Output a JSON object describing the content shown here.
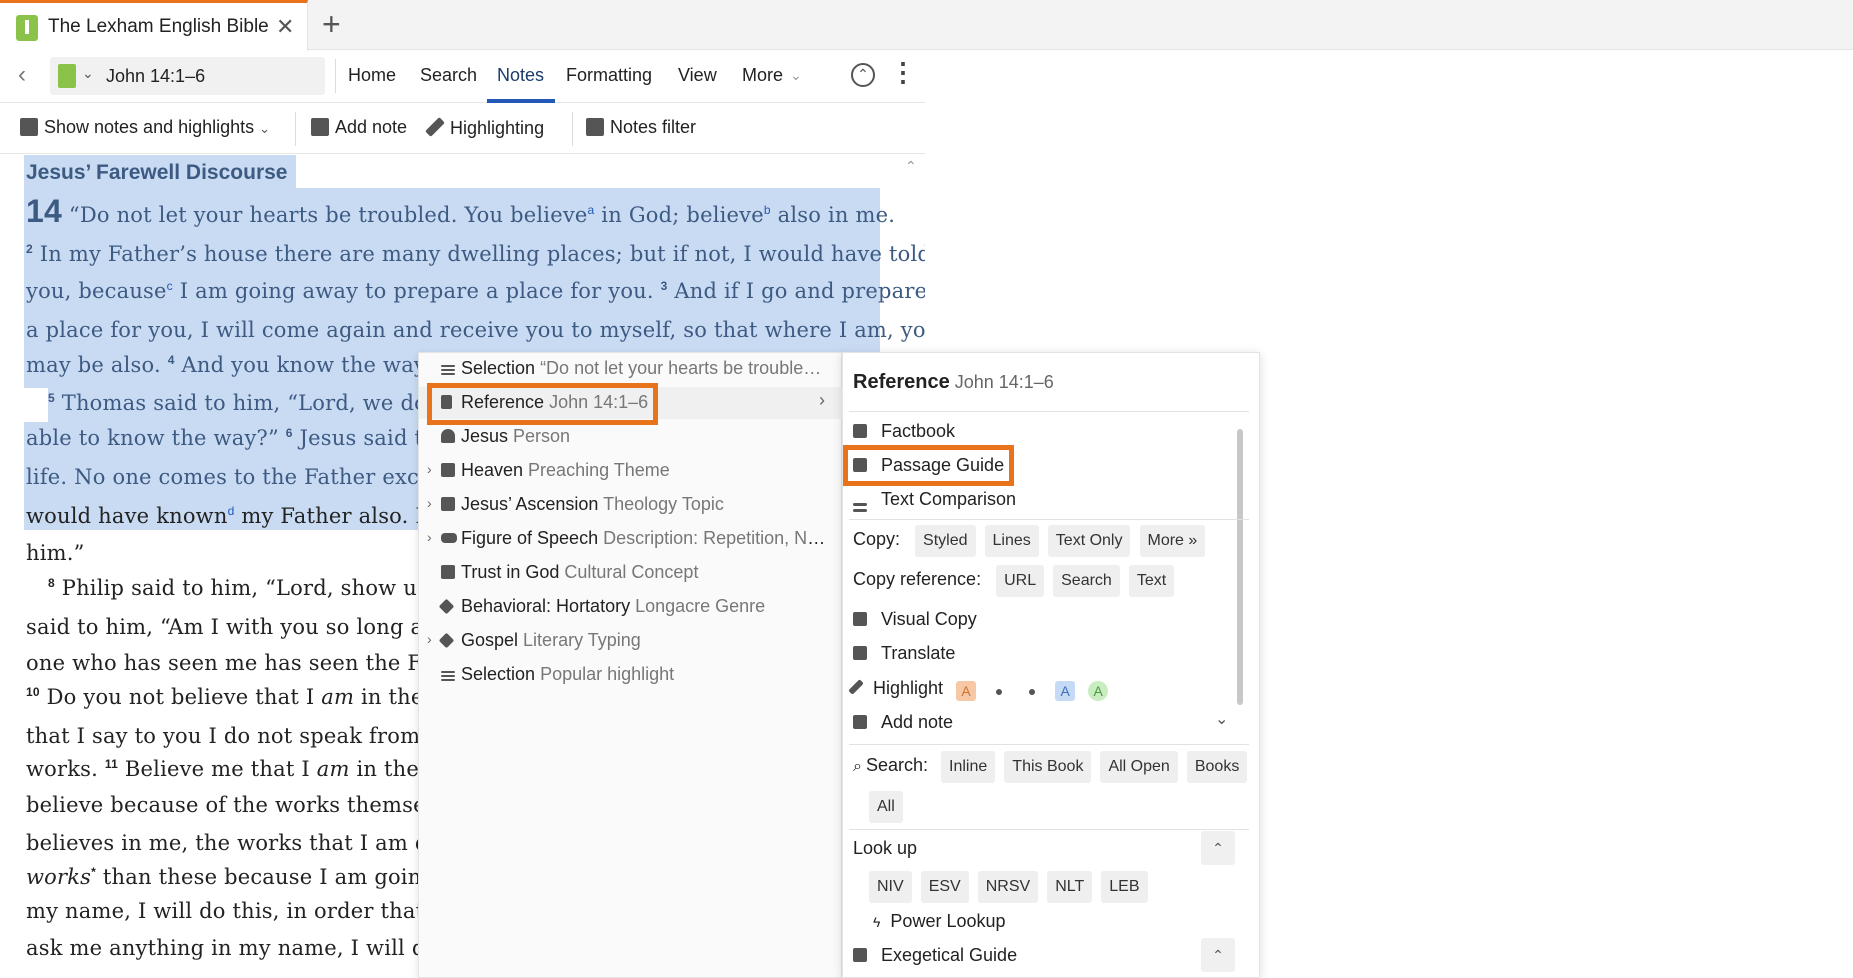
{
  "tab": {
    "title": "The Lexham English Bible",
    "close": "✕",
    "add": "+"
  },
  "nav": {
    "back": "‹",
    "reference": "John 14:1–6",
    "dropdown": "⌄",
    "menu": [
      "Home",
      "Search",
      "Notes",
      "Formatting",
      "View",
      "More"
    ],
    "more_chevron": "⌄",
    "active": "Notes"
  },
  "toolbar": {
    "show_notes": "Show notes and highlights",
    "show_chevron": "⌄",
    "add_note": "Add note",
    "highlighting": "Highlighting",
    "notes_filter": "Notes filter"
  },
  "text": {
    "heading": "Jesus’ Farewell Discourse",
    "chapter": "14",
    "l1": "“Do not let your hearts be troubled. You believe",
    "l1_note_a": "a",
    "l1_b": " in God; believe",
    "l1_note_b": "b",
    "l1_c": " also in me.",
    "v2": "2",
    "l2": " In my Father’s house there are many dwelling places; but if not, I would have told",
    "l3a": "you, because",
    "l3_note_c": "c",
    "l3b": " I am going away to prepare a place for you. ",
    "v3": "3",
    "l3c": " And if I go and prepare",
    "l4": "a place for you, I will come again and receive you to myself, so that where I am, you",
    "l5a": "may be also. ",
    "v4": "4",
    "l5b": " And you know the way w",
    "v5": "5",
    "l6": " Thomas said to him, “Lord, we do",
    "l7a": "able to know the way?” ",
    "v6": "6",
    "l7b": " Jesus said to",
    "l8": "life. No one comes to the Father exce",
    "l9a": "would have known",
    "l9_note_d": "d",
    "l9b": " my Father also. F",
    "l10": "him.”",
    "v8": "8",
    "l11": " Philip said to him, “Lord, show us",
    "l12": "said to him, “Am I with you so long a ti",
    "l13": "one who has seen me has seen the Fat",
    "v10": "10",
    "l14a": " Do you not believe that I ",
    "l14_am": "am",
    "l14b": " in the",
    "l15": "that I say to you I do not speak from m",
    "l16a": "works. ",
    "v11": "11",
    "l16b": " Believe me that I ",
    "l16_am": "am",
    "l16c": " in the",
    "l17": "believe because of the works themsel",
    "l18": "believes in me, the works that I am d",
    "l19a": "works",
    "l19_star": "*",
    "l19b": " than these because I am going",
    "l20": "my name, I will do this, in order that th",
    "l21": "ask me anything in my name, I will do i",
    "scroll_up": "⌃"
  },
  "menu1": {
    "items": [
      {
        "label": "Selection",
        "sub": " “Do not let your hearts be trouble…",
        "chev": ""
      },
      {
        "label": "Reference",
        "sub": " John 14:1–6",
        "chev": ""
      },
      {
        "label": "Jesus",
        "sub": " Person",
        "chev": ""
      },
      {
        "label": "Heaven",
        "sub": " Preaching Theme",
        "chev": "›"
      },
      {
        "label": "Jesus’ Ascension",
        "sub": " Theology Topic",
        "chev": "›"
      },
      {
        "label": "Figure of Speech",
        "sub": " Description: Repetition, Na…",
        "chev": "›"
      },
      {
        "label": "Trust in God",
        "sub": " Cultural Concept",
        "chev": ""
      },
      {
        "label": "Behavioral: Hortatory",
        "sub": " Longacre Genre",
        "chev": ""
      },
      {
        "label": "Gospel",
        "sub": " Literary Typing",
        "chev": "›"
      },
      {
        "label": "Selection",
        "sub": " Popular highlight",
        "chev": ""
      }
    ],
    "arrow": "›"
  },
  "menu2": {
    "title": "Reference",
    "title_sub": " John 14:1–6",
    "factbook": "Factbook",
    "passage_guide": "Passage Guide",
    "text_comparison": "Text Comparison",
    "copy_label": "Copy:",
    "copy_chips": [
      "Styled",
      "Lines",
      "Text Only",
      "More »"
    ],
    "copy_ref_label": "Copy reference:",
    "copy_ref_chips": [
      "URL",
      "Search",
      "Text"
    ],
    "visual_copy": "Visual Copy",
    "translate": "Translate",
    "highlight": "Highlight",
    "highlight_chip_a": "A",
    "add_note": "Add note",
    "add_note_chevron": "⌄",
    "search_label": "Search:",
    "search_chips": [
      "Inline",
      "This Book",
      "All Open",
      "Books",
      "All"
    ],
    "look_up": "Look up",
    "collapse": "⌃",
    "lookup_chips": [
      "NIV",
      "ESV",
      "NRSV",
      "NLT",
      "LEB"
    ],
    "power_lookup": "Power Lookup",
    "exegetical_guide": "Exegetical Guide",
    "colors": {
      "accent": "#e8731a",
      "highlight_orange": "#f6c8a5",
      "highlight_blue": "#c6d9f5",
      "highlight_green": "#c9ecc0"
    }
  }
}
